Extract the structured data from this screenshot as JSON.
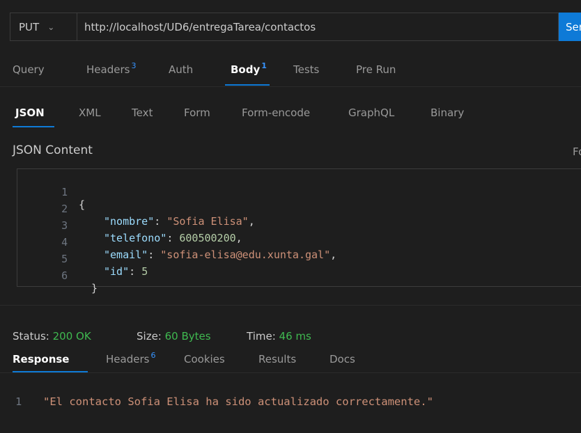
{
  "request": {
    "method": "PUT",
    "url": "http://localhost/UD6/entregaTarea/contactos",
    "send_label": "Send"
  },
  "request_tabs": [
    {
      "label": "Query",
      "badge": ""
    },
    {
      "label": "Headers",
      "badge": "3"
    },
    {
      "label": "Auth",
      "badge": ""
    },
    {
      "label": "Body",
      "badge": "1"
    },
    {
      "label": "Tests",
      "badge": ""
    },
    {
      "label": "Pre Run",
      "badge": ""
    }
  ],
  "active_request_tab": "Body",
  "body_types": [
    "JSON",
    "XML",
    "Text",
    "Form",
    "Form-encode",
    "GraphQL",
    "Binary"
  ],
  "active_body_type": "JSON",
  "editor": {
    "title": "JSON Content",
    "format_label": "Format",
    "line_numbers": [
      "1",
      "2",
      "3",
      "4",
      "5",
      "6"
    ],
    "lines": [
      {
        "indent": "",
        "key": "",
        "sep": "",
        "value": "",
        "open": "{",
        "trail": ""
      },
      {
        "indent": "   ",
        "key": "\"nombre\"",
        "sep": ": ",
        "value": "\"Sofia Elisa\"",
        "vtype": "string",
        "trail": ","
      },
      {
        "indent": "   ",
        "key": "\"telefono\"",
        "sep": ": ",
        "value": "600500200",
        "vtype": "number",
        "trail": ","
      },
      {
        "indent": "   ",
        "key": "\"email\"",
        "sep": ": ",
        "value": "\"sofia-elisa@edu.xunta.gal\"",
        "vtype": "string",
        "trail": ","
      },
      {
        "indent": "   ",
        "key": "\"id\"",
        "sep": ": ",
        "value": "5",
        "vtype": "number",
        "trail": ""
      },
      {
        "indent": " ",
        "key": "",
        "sep": "",
        "value": "",
        "open": "}",
        "trail": ""
      }
    ]
  },
  "status": {
    "status_label": "Status:",
    "status_value": "200 OK",
    "size_label": "Size:",
    "size_value": "60 Bytes",
    "time_label": "Time:",
    "time_value": "46 ms"
  },
  "response_tabs": [
    {
      "label": "Response",
      "badge": ""
    },
    {
      "label": "Headers",
      "badge": "6"
    },
    {
      "label": "Cookies",
      "badge": ""
    },
    {
      "label": "Results",
      "badge": ""
    },
    {
      "label": "Docs",
      "badge": ""
    }
  ],
  "active_response_tab": "Response",
  "response": {
    "line_number": "1",
    "text": "\"El contacto Sofia Elisa ha sido actualizado correctamente.\""
  },
  "colors": {
    "background": "#1e1e1e",
    "accent": "#0e7ad7",
    "badge": "#3794ff",
    "success": "#3fb950",
    "json_key": "#9cdcfe",
    "json_string": "#ce9178",
    "json_number": "#b5cea8"
  }
}
